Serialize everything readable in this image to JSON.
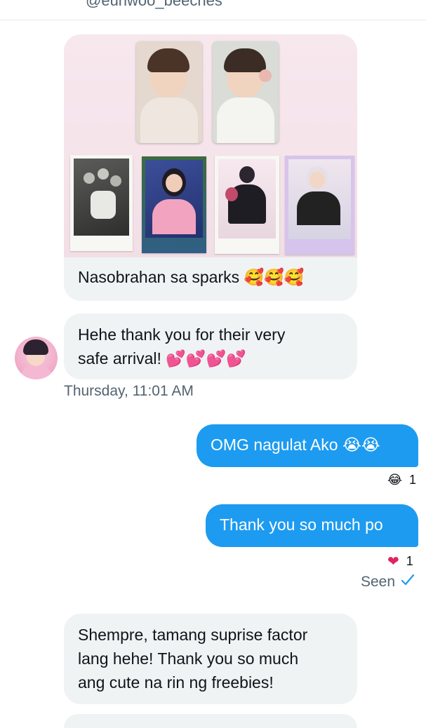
{
  "header": {
    "handle": "@eunwoo_beeches"
  },
  "messages": {
    "m1": {
      "text": "Nasobrahan sa sparks",
      "emoji": "🥰🥰🥰"
    },
    "m2": {
      "line1": "Hehe thank you for their very",
      "line2": "safe arrival!",
      "emoji": "💕💕💕💕"
    },
    "timestamp": "Thursday, 11:01 AM",
    "m3": {
      "text": "OMG nagulat Ako",
      "emoji": "😭😭",
      "reaction_emoji": "😂",
      "reaction_count": "1"
    },
    "m4": {
      "text": "Thank you so much po",
      "reaction_emoji": "❤",
      "reaction_count": "1"
    },
    "seen": {
      "label": "Seen",
      "icon": "check-icon"
    },
    "m5": {
      "line1": "Shempre, tamang suprise factor",
      "line2": "lang hehe! Thank you so much",
      "line3": "ang cute na rin ng freebies!"
    }
  },
  "colors": {
    "accent": "#1d9bf0",
    "bubble_received": "#eff3f4",
    "muted_text": "#536471",
    "heart": "#e0245e"
  }
}
